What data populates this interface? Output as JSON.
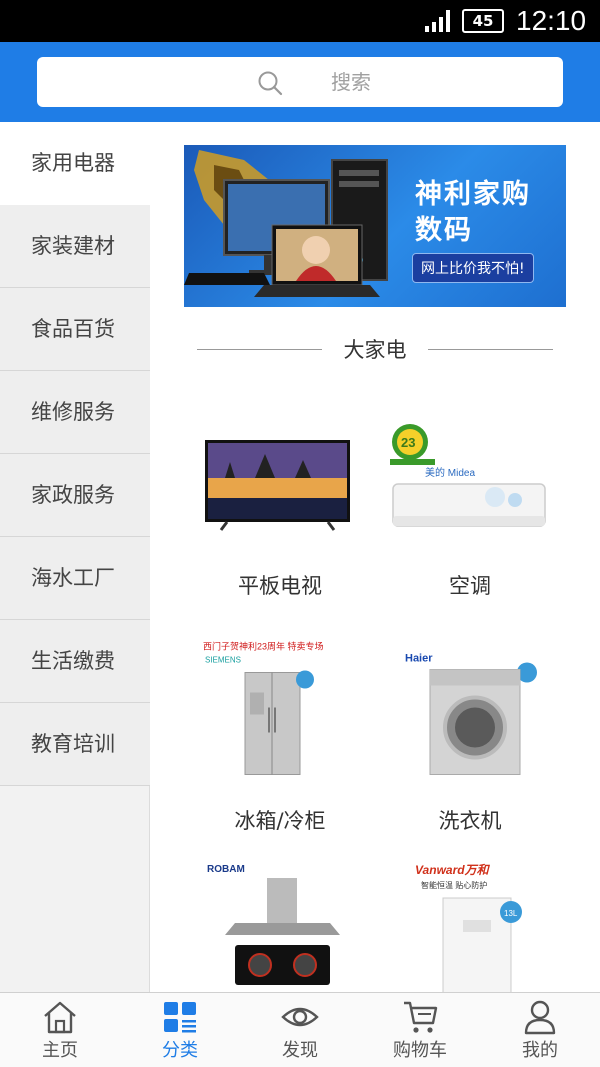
{
  "status_bar": {
    "battery": "45",
    "time": "12:10"
  },
  "search": {
    "placeholder": "搜索"
  },
  "sidebar": {
    "items": [
      {
        "label": "家用电器",
        "active": true
      },
      {
        "label": "家装建材"
      },
      {
        "label": "食品百货"
      },
      {
        "label": "维修服务"
      },
      {
        "label": "家政服务"
      },
      {
        "label": "海水工厂"
      },
      {
        "label": "生活缴费"
      },
      {
        "label": "教育培训"
      }
    ]
  },
  "banner": {
    "title": "神利家购数码",
    "subtitle": "网上比价我不怕!"
  },
  "section": {
    "title": "大家电"
  },
  "products": [
    {
      "label": "平板电视",
      "icon": "tv-image"
    },
    {
      "label": "空调",
      "icon": "air-conditioner-image",
      "badge": "23"
    },
    {
      "label": "冰箱/冷柜",
      "icon": "refrigerator-image",
      "promo": "西门子贺神利23周年 特卖专场",
      "brand": "SIEMENS"
    },
    {
      "label": "洗衣机",
      "icon": "washing-machine-image",
      "brand": "Haier"
    },
    {
      "label": "",
      "icon": "range-hood-image",
      "brand": "ROBAM"
    },
    {
      "label": "",
      "icon": "water-heater-image",
      "brand": "Vanward万和",
      "tagline": "智能恒温 贴心防护",
      "size_badge": "13L"
    }
  ],
  "tabbar": {
    "items": [
      {
        "label": "主页",
        "icon": "home-icon"
      },
      {
        "label": "分类",
        "icon": "category-icon",
        "active": true
      },
      {
        "label": "发现",
        "icon": "eye-icon"
      },
      {
        "label": "购物车",
        "icon": "cart-icon"
      },
      {
        "label": "我的",
        "icon": "user-icon"
      }
    ]
  },
  "colors": {
    "primary": "#1f7de6",
    "sidebar_bg": "#eeeeee",
    "active_bg": "#ffffff"
  }
}
